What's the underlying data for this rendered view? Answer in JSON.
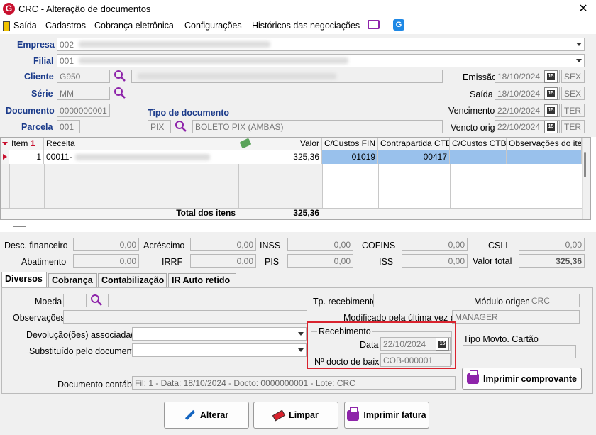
{
  "window": {
    "title": "CRC - Alteração de documentos",
    "close_label": "✕",
    "logo_letter": "G"
  },
  "menu": [
    {
      "label": "Saída"
    },
    {
      "label": "Cadastros"
    },
    {
      "label": "Cobrança eletrônica"
    },
    {
      "label": "Configurações"
    },
    {
      "label": "Históricos das negociações"
    }
  ],
  "header": {
    "empresa_label": "Empresa",
    "empresa_code": "002",
    "filial_label": "Filial",
    "filial_code": "001",
    "cliente_label": "Cliente",
    "cliente_code": "G950",
    "serie_label": "Série",
    "serie_value": "MM",
    "documento_label": "Documento",
    "documento_value": "0000000001",
    "parcela_label": "Parcela",
    "parcela_value": "001",
    "tipo_doc_label": "Tipo de documento",
    "tipo_doc_code": "PIX",
    "tipo_doc_desc": "BOLETO PIX (AMBAS)",
    "emissao_label": "Emissão",
    "emissao_date": "18/10/2024",
    "emissao_day": "SEX",
    "saida_label": "Saída",
    "saida_date": "18/10/2024",
    "saida_day": "SEX",
    "vencimento_label": "Vencimento",
    "vencimento_date": "22/10/2024",
    "vencimento_day": "TER",
    "vencto_orig_label": "Vencto orig",
    "vencto_orig_date": "22/10/2024",
    "vencto_orig_day": "TER",
    "cal_icon_text": "15"
  },
  "grid": {
    "columns": [
      "Item",
      "Receita",
      "Valor",
      "C/Custos FIN",
      "Contrapartida CTB",
      "C/Custos CTB",
      "Observações do item"
    ],
    "sort_indicator": "1",
    "rows": [
      {
        "item": "1",
        "receita": "00011-",
        "valor": "325,36",
        "ccfin": "01019",
        "contrapartida": "00417",
        "ccctb": "",
        "obs": ""
      }
    ],
    "total_label": "Total dos itens",
    "total_value": "325,36"
  },
  "totals": {
    "desc_fin_label": "Desc. financeiro",
    "desc_fin": "0,00",
    "acrescimo_label": "Acréscimo",
    "acrescimo": "0,00",
    "inss_label": "INSS",
    "inss": "0,00",
    "cofins_label": "COFINS",
    "cofins": "0,00",
    "csll_label": "CSLL",
    "csll": "0,00",
    "abatimento_label": "Abatimento",
    "abatimento": "0,00",
    "irrf_label": "IRRF",
    "irrf": "0,00",
    "pis_label": "PIS",
    "pis": "0,00",
    "iss_label": "ISS",
    "iss": "0,00",
    "valor_total_label": "Valor total",
    "valor_total": "325,36"
  },
  "tabs": [
    {
      "label": "Diversos",
      "active": true
    },
    {
      "label": "Cobrança"
    },
    {
      "label": "Contabilização"
    },
    {
      "label": "IR Auto retido"
    }
  ],
  "diversos": {
    "moeda_label": "Moeda",
    "observacoes_label": "Observações",
    "devolucao_label": "Devolução(ões) associada(s)",
    "substituido_label": "Substituído pelo documento",
    "documento_contabil_label": "Documento contábil",
    "documento_contabil_value": "Fil: 1 - Data: 18/10/2024 - Docto: 0000000001 - Lote: CRC",
    "tp_recebimento_label": "Tp. recebimento",
    "modulo_origem_label": "Módulo origem",
    "modulo_origem_value": "CRC",
    "modificado_label": "Modificado pela última vez por",
    "modificado_value": "MANAGER",
    "recebimento_group_label": "Recebimento",
    "data_label": "Data",
    "data_value": "22/10/2024",
    "docto_baixa_label": "Nº docto de baixa",
    "docto_baixa_value": "COB-000001",
    "tipo_movto_label": "Tipo Movto. Cartão",
    "imprimir_comprovante_label": "Imprimir comprovante"
  },
  "buttons": {
    "alterar_label": "Alterar",
    "limpar_label": "Limpar",
    "imprimir_fatura_label": "Imprimir fatura"
  },
  "colors": {
    "highlight_border": "#d9232e",
    "selected_row": "#99c1ec",
    "label_blue": "#1a3a8a"
  }
}
